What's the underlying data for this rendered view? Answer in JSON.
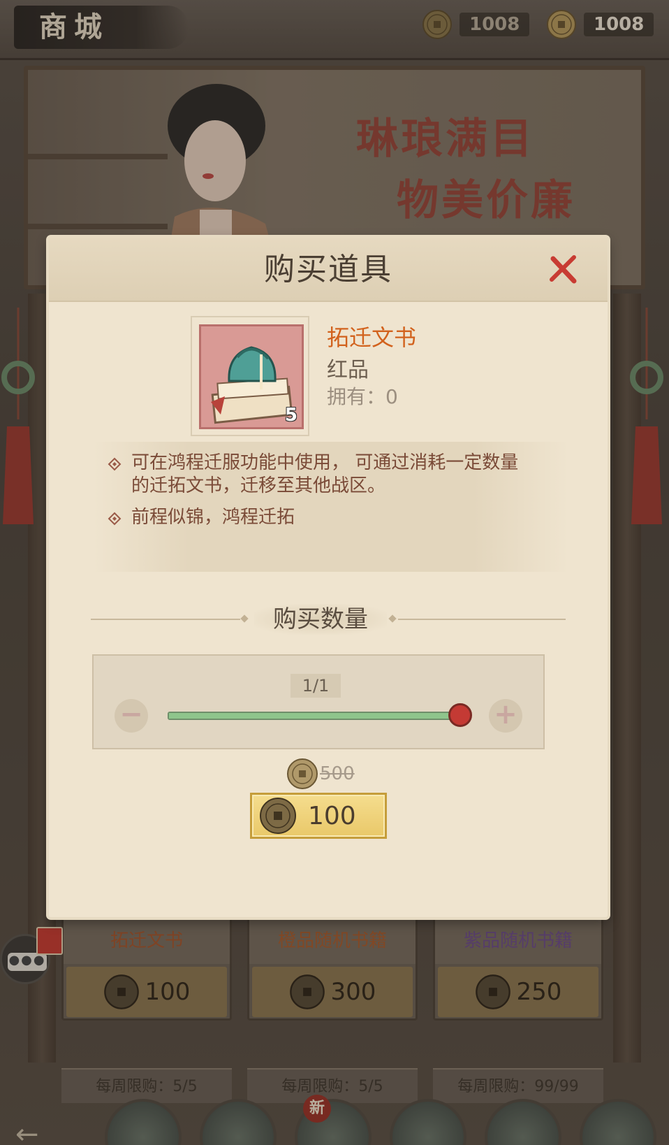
{
  "header": {
    "title": "商城",
    "currency_1": "1008",
    "currency_2": "1008"
  },
  "banner": {
    "slogan_line1": "琳琅满目",
    "slogan_line2": "物美价廉"
  },
  "dialog": {
    "title": "购买道具",
    "item": {
      "name": "拓迁文书",
      "rarity": "红品",
      "owned": "拥有：0",
      "icon_count": "5",
      "icon": "seal-on-books-icon"
    },
    "descriptions": [
      "可在鸿程迁服功能中使用， 可通过消耗一定数量的迁拓文书，迁移至其他战区。",
      "前程似锦，鸿程迁拓"
    ],
    "quantity_label": "购买数量",
    "quantity_value": "1/1",
    "quantity_fraction": 1.0,
    "original_price": "500",
    "price": "100"
  },
  "shop_items": [
    {
      "name": "拓迁文书",
      "price": "100"
    },
    {
      "name": "橙品随机书籍",
      "price": "300"
    },
    {
      "name": "紫品随机书籍",
      "price": "250"
    }
  ],
  "limits": [
    "每周限购：5/5",
    "每周限购：5/5",
    "每周限购：99/99"
  ],
  "nav": {
    "new_badge": "新"
  },
  "colors": {
    "accent_red": "#c43a34",
    "item_name_orange": "#d2621d",
    "slider_green": "#8fc58c",
    "gold_button": "#e9c869"
  }
}
